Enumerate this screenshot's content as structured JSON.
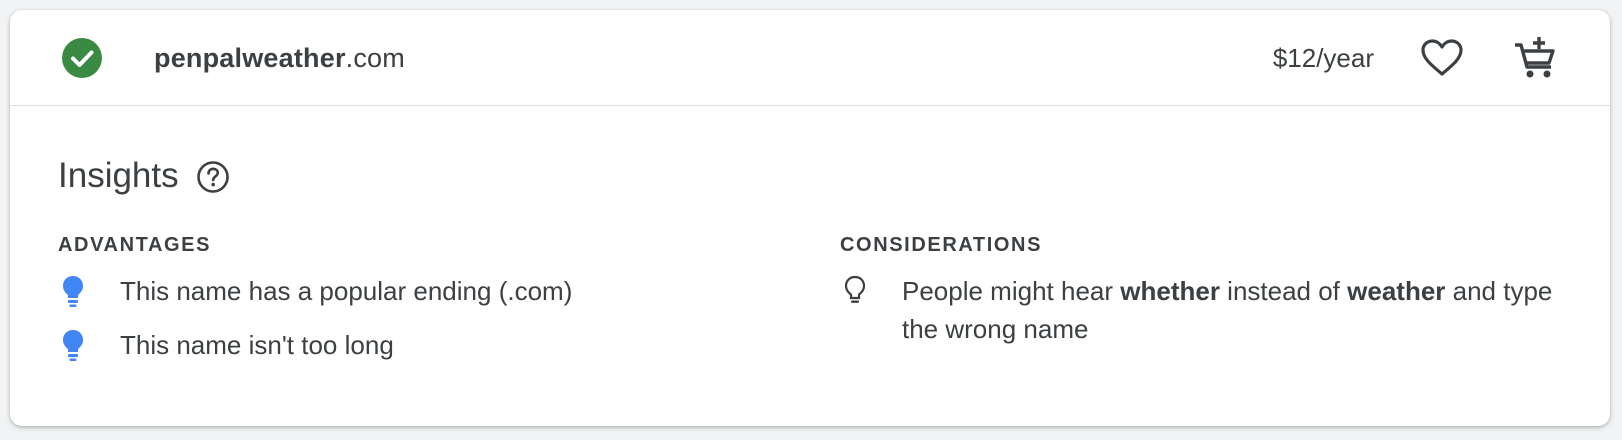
{
  "result": {
    "domain_name": "penpalweather",
    "domain_tld": ".com",
    "price": "$12/year",
    "status_color": "#34a853"
  },
  "insights": {
    "title": "Insights",
    "advantages": {
      "title": "ADVANTAGES",
      "items": [
        "This name has a popular ending (.com)",
        "This name isn't too long"
      ]
    },
    "considerations": {
      "title": "CONSIDERATIONS",
      "items": [
        {
          "part1": "People might hear ",
          "bold1": "whether",
          "part2": " instead of ",
          "bold2": "weather",
          "part3": " and type the wrong name"
        }
      ]
    }
  },
  "icons": {
    "status": "check-circle-icon",
    "favorite": "heart-outline-icon",
    "cart": "add-shopping-cart-icon",
    "help": "help-circle-icon",
    "advantage_bullet": "lightbulb-filled-icon",
    "consideration_bullet": "lightbulb-outline-icon"
  },
  "colors": {
    "accent_blue": "#4285f4",
    "check_green": "#34a853",
    "text": "#3c4043"
  }
}
